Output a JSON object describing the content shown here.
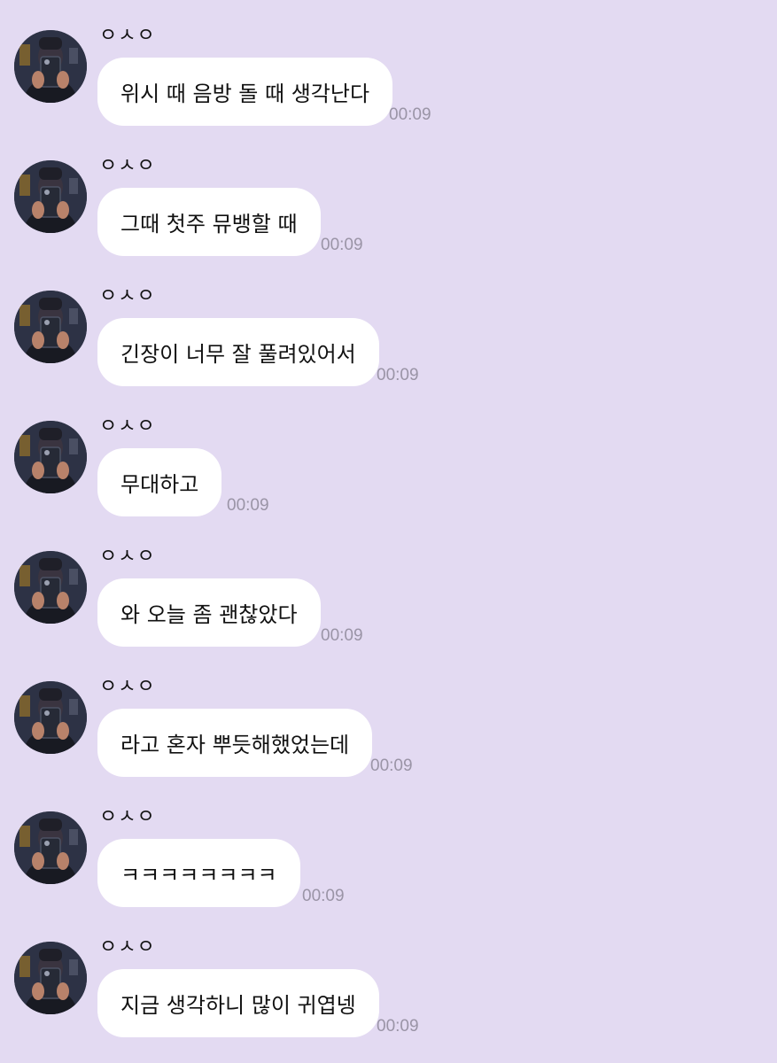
{
  "messages": [
    {
      "sender": "ㅇㅅㅇ",
      "text": "위시 때 음방 돌 때 생각난다",
      "time": "00:09"
    },
    {
      "sender": "ㅇㅅㅇ",
      "text": "그때 첫주 뮤뱅할 때",
      "time": "00:09"
    },
    {
      "sender": "ㅇㅅㅇ",
      "text": "긴장이 너무 잘 풀려있어서",
      "time": "00:09"
    },
    {
      "sender": "ㅇㅅㅇ",
      "text": "무대하고",
      "time": "00:09"
    },
    {
      "sender": "ㅇㅅㅇ",
      "text": "와 오늘 좀 괜찮았다",
      "time": "00:09"
    },
    {
      "sender": "ㅇㅅㅇ",
      "text": "라고 혼자 뿌듯해했었는데",
      "time": "00:09"
    },
    {
      "sender": "ㅇㅅㅇ",
      "text": "ㅋㅋㅋㅋㅋㅋㅋㅋ",
      "time": "00:09"
    },
    {
      "sender": "ㅇㅅㅇ",
      "text": "지금 생각하니 많이 귀엽넹",
      "time": "00:09"
    }
  ],
  "colors": {
    "background": "#e3daf2",
    "bubble": "#ffffff",
    "timestamp": "#9a94a6"
  },
  "icons": {
    "avatar": "profile-photo-mirror-selfie"
  }
}
